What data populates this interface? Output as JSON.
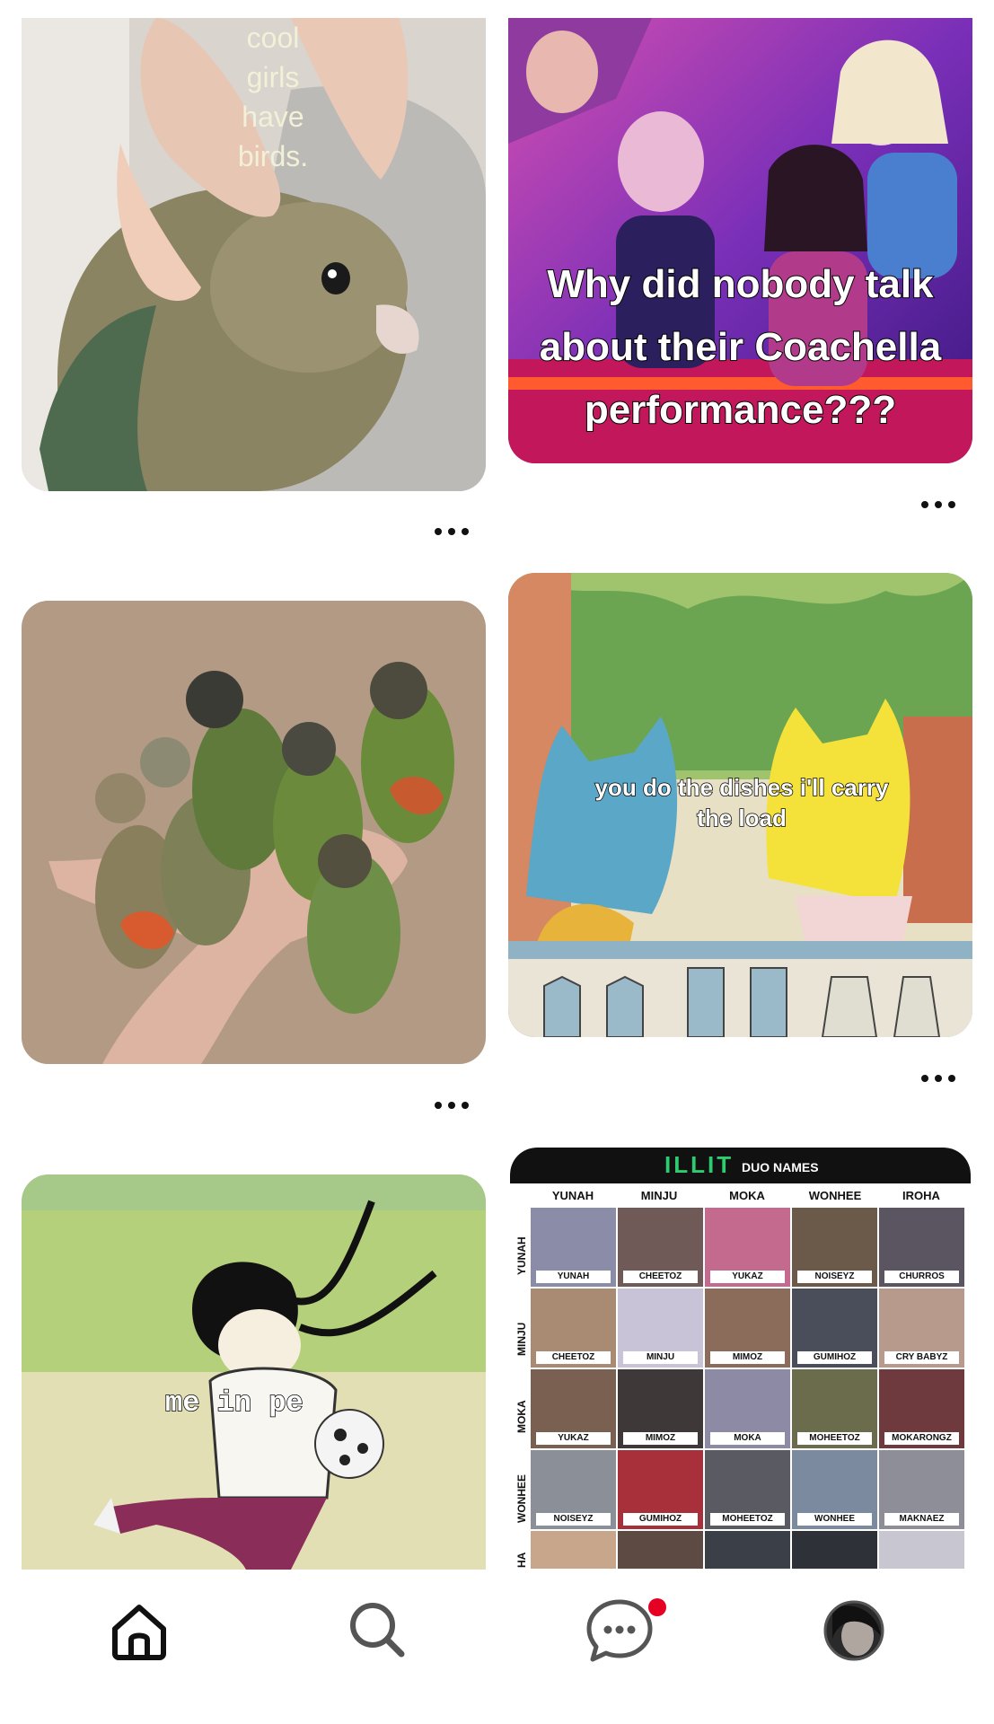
{
  "pins": {
    "bird_pin": {
      "caption_lines": [
        "cool",
        "girls",
        "have",
        "birds."
      ]
    },
    "coachella_pin": {
      "caption_lines": [
        "Why did nobody talk",
        "about their Coachella",
        "performance???"
      ]
    },
    "parrots_pin": {},
    "cats_pin": {
      "caption_lines": [
        "you do the dishes i'll carry",
        "the load"
      ]
    },
    "soccer_pin": {
      "caption": "me in pe"
    },
    "illit_pin": {
      "title": "ILLIT",
      "subtitle": "DUO NAMES",
      "columns": [
        "YUNAH",
        "MINJU",
        "MOKA",
        "WONHEE",
        "IROHA"
      ],
      "rows": [
        "YUNAH",
        "MINJU",
        "MOKA",
        "WONHEE",
        "HA"
      ],
      "cells": [
        [
          "YUNAH",
          "CHEETOZ",
          "YUKAZ",
          "NOISEYZ",
          "CHURROS"
        ],
        [
          "CHEETOZ",
          "MINJU",
          "MIMOZ",
          "GUMIHOZ",
          "CRY BABYZ"
        ],
        [
          "YUKAZ",
          "MIMOZ",
          "MOKA",
          "MOHEETOZ",
          "MOKARONGZ"
        ],
        [
          "NOISEYZ",
          "GUMIHOZ",
          "MOHEETOZ",
          "WONHEE",
          "MAKNAEZ"
        ]
      ]
    }
  },
  "nav": {
    "items": [
      {
        "name": "home",
        "icon": "home-icon"
      },
      {
        "name": "search",
        "icon": "search-icon"
      },
      {
        "name": "messages",
        "icon": "chat-bubble-icon",
        "badge_color": "#e60023"
      },
      {
        "name": "profile",
        "icon": "avatar"
      }
    ]
  },
  "colors": {
    "accent": "#e60023",
    "text": "#111111",
    "background": "#ffffff"
  }
}
